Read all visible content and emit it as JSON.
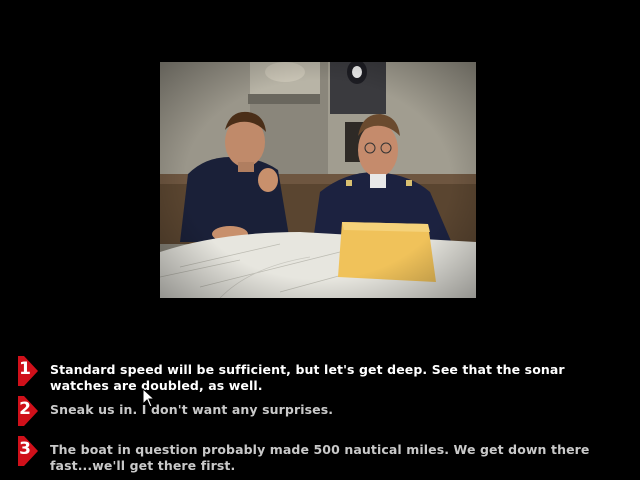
{
  "scene": {
    "video_label": "briefing-video"
  },
  "choices": [
    {
      "number": "1",
      "text": "Standard speed will be sufficient, but let's get deep. See that the sonar watches are doubled, as well.",
      "state": "highlighted"
    },
    {
      "number": "2",
      "text": "Sneak us in. I don't want any surprises.",
      "state": "normal"
    },
    {
      "number": "3",
      "text": "The boat in question probably made 500 nautical miles. We get down there fast...we'll get there first.",
      "state": "normal"
    }
  ],
  "colors": {
    "badge_red": "#d0101a",
    "highlight_text": "#ffffff",
    "normal_text": "#c9c9c9",
    "background": "#000000"
  },
  "icons": [
    "red-arrow-badge-icon",
    "mouse-pointer-icon"
  ]
}
